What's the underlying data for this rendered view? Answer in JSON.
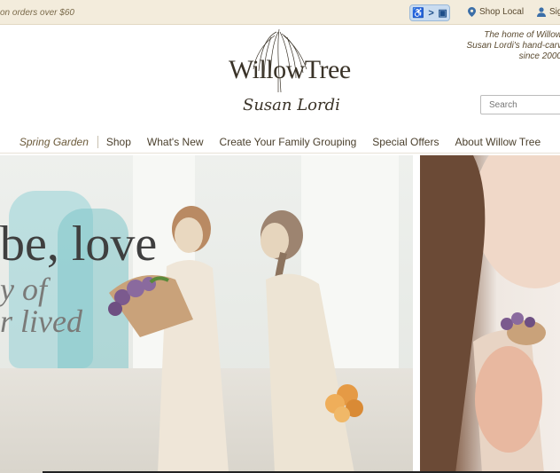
{
  "topbar": {
    "promo": "on orders over $60",
    "accessibility": {
      "icon1": "wheelchair-icon",
      "sep": ">",
      "icon2": "screen-icon"
    },
    "shop_local": "Shop Local",
    "sign_in": "Sig"
  },
  "header": {
    "logo_word": "WillowTree",
    "logo_signature": "Susan Lordi",
    "tagline": [
      "The home of Willow",
      "Susan Lordi's hand-carv",
      "since 2000"
    ],
    "search_placeholder": "Search"
  },
  "nav": {
    "items": [
      "Spring Garden",
      "Shop",
      "What's New",
      "Create Your Family Grouping",
      "Special Offers",
      "About Willow Tree"
    ]
  },
  "hero": {
    "line1": "be, love",
    "line2": "y of",
    "line3": "r lived"
  },
  "colors": {
    "topbar_bg": "#f3ecdc",
    "text": "#4a3f2c"
  }
}
